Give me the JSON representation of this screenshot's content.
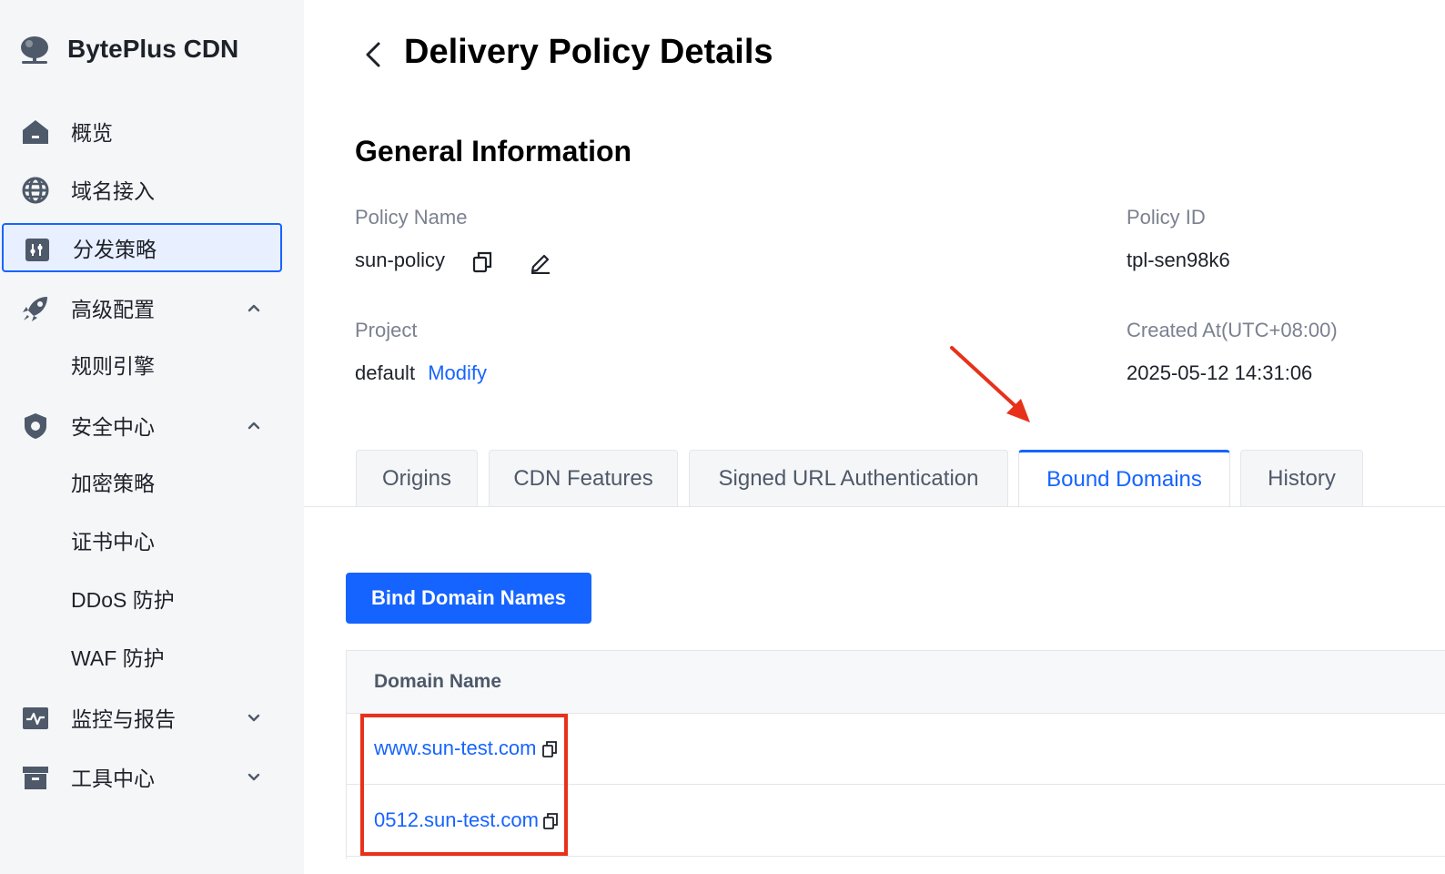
{
  "app": {
    "title": "BytePlus CDN"
  },
  "sidebar": {
    "items": [
      {
        "label": "概览",
        "icon": "home-icon"
      },
      {
        "label": "域名接入",
        "icon": "globe-icon"
      },
      {
        "label": "分发策略",
        "icon": "policy-icon",
        "active": true
      },
      {
        "label": "高级配置",
        "icon": "rocket-icon",
        "expanded": true
      },
      {
        "label": "规则引擎",
        "sub": true
      },
      {
        "label": "安全中心",
        "icon": "shield-icon",
        "expanded": true
      },
      {
        "label": "加密策略",
        "sub": true
      },
      {
        "label": "证书中心",
        "sub": true
      },
      {
        "label": "DDoS 防护",
        "sub": true
      },
      {
        "label": "WAF 防护",
        "sub": true
      },
      {
        "label": "监控与报告",
        "icon": "monitor-icon",
        "expanded": false
      },
      {
        "label": "工具中心",
        "icon": "toolbox-icon",
        "expanded": false
      }
    ]
  },
  "header": {
    "title": "Delivery Policy Details"
  },
  "general": {
    "title": "General Information",
    "policy_name_label": "Policy Name",
    "policy_name": "sun-policy",
    "policy_id_label": "Policy ID",
    "policy_id": "tpl-sen98k6",
    "project_label": "Project",
    "project": "default",
    "modify_label": "Modify",
    "created_label": "Created At(UTC+08:00)",
    "created": "2025-05-12 14:31:06"
  },
  "tabs": [
    {
      "label": "Origins"
    },
    {
      "label": "CDN Features"
    },
    {
      "label": "Signed URL Authentication"
    },
    {
      "label": "Bound Domains",
      "active": true
    },
    {
      "label": "History"
    }
  ],
  "bound": {
    "bind_button": "Bind Domain Names",
    "column_header": "Domain Name",
    "rows": [
      {
        "domain": "www.sun-test.com"
      },
      {
        "domain": "0512.sun-test.com"
      }
    ]
  },
  "colors": {
    "accent": "#1664ff",
    "annotation": "#e8311a",
    "sidebar_bg": "#f5f6f8"
  }
}
